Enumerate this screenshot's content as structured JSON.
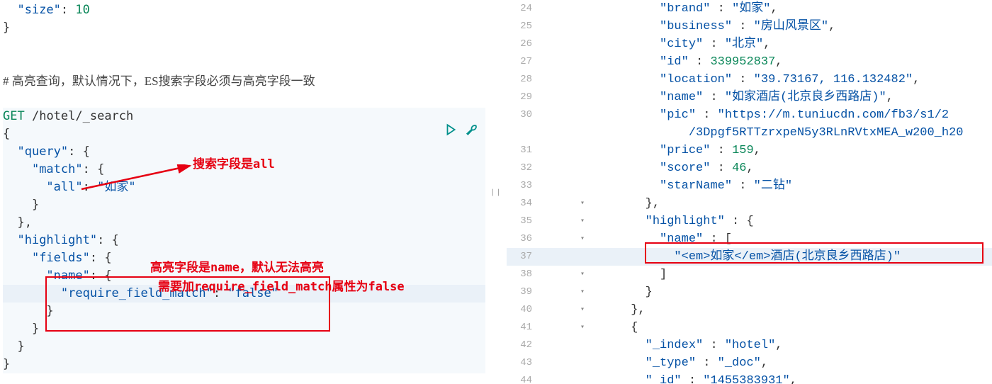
{
  "left": {
    "top_fragment": {
      "key": "\"size\"",
      "val": "10"
    },
    "comment": "# 高亮查询，默认情况下，ES搜索字段必须与高亮字段一致",
    "method": "GET",
    "url": "/hotel/_search",
    "body": {
      "query_key": "\"query\"",
      "match_key": "\"match\"",
      "all_key": "\"all\"",
      "all_val": "\"如家\"",
      "highlight_key": "\"highlight\"",
      "fields_key": "\"fields\"",
      "name_key": "\"name\"",
      "rfm_key": "\"require_field_match\"",
      "rfm_val": "\"false\""
    },
    "anno1": "搜索字段是all",
    "anno2": "高亮字段是name，默认无法高亮",
    "anno3": "需要加require_field_match属性为false"
  },
  "right": {
    "lines": [
      {
        "n": 24,
        "ind": 5,
        "text": "\"brand\" : \"如家\",",
        "segs": [
          [
            "key",
            "\"brand\""
          ],
          [
            "p",
            " : "
          ],
          [
            "str",
            "\"如家\""
          ],
          [
            "p",
            ","
          ]
        ]
      },
      {
        "n": 25,
        "ind": 5,
        "text": "\"business\" : \"房山风景区\",",
        "segs": [
          [
            "key",
            "\"business\""
          ],
          [
            "p",
            " : "
          ],
          [
            "str",
            "\"房山风景区\""
          ],
          [
            "p",
            ","
          ]
        ]
      },
      {
        "n": 26,
        "ind": 5,
        "text": "\"city\" : \"北京\",",
        "segs": [
          [
            "key",
            "\"city\""
          ],
          [
            "p",
            " : "
          ],
          [
            "str",
            "\"北京\""
          ],
          [
            "p",
            ","
          ]
        ]
      },
      {
        "n": 27,
        "ind": 5,
        "text": "\"id\" : 339952837,",
        "segs": [
          [
            "key",
            "\"id\""
          ],
          [
            "p",
            " : "
          ],
          [
            "num",
            "339952837"
          ],
          [
            "p",
            ","
          ]
        ]
      },
      {
        "n": 28,
        "ind": 5,
        "text": "\"location\" : \"39.73167, 116.132482\",",
        "segs": [
          [
            "key",
            "\"location\""
          ],
          [
            "p",
            " : "
          ],
          [
            "str",
            "\"39.73167, 116.132482\""
          ],
          [
            "p",
            ","
          ]
        ]
      },
      {
        "n": 29,
        "ind": 5,
        "text": "\"name\" : \"如家酒店(北京良乡西路店)\",",
        "segs": [
          [
            "key",
            "\"name\""
          ],
          [
            "p",
            " : "
          ],
          [
            "str",
            "\"如家酒店(北京良乡西路店)\""
          ],
          [
            "p",
            ","
          ]
        ]
      },
      {
        "n": 30,
        "ind": 5,
        "text": "\"pic\" : \"https://m.tuniucdn.com/fb3/s1/2…",
        "segs": [
          [
            "key",
            "\"pic\""
          ],
          [
            "p",
            " : "
          ],
          [
            "str",
            "\"https://m.tuniucdn.com/fb3/s1/2"
          ]
        ]
      },
      {
        "n": "30b",
        "ind": 6,
        "text": "/3Dpgf5RTTzrxpeN5y3RLnRVtxMEA_w200_h20",
        "segs": [
          [
            "str",
            "  /3Dpgf5RTTzrxpeN5y3RLnRVtxMEA_w200_h20"
          ]
        ]
      },
      {
        "n": 31,
        "ind": 5,
        "text": "\"price\" : 159,",
        "segs": [
          [
            "key",
            "\"price\""
          ],
          [
            "p",
            " : "
          ],
          [
            "num",
            "159"
          ],
          [
            "p",
            ","
          ]
        ]
      },
      {
        "n": 32,
        "ind": 5,
        "text": "\"score\" : 46,",
        "segs": [
          [
            "key",
            "\"score\""
          ],
          [
            "p",
            " : "
          ],
          [
            "num",
            "46"
          ],
          [
            "p",
            ","
          ]
        ]
      },
      {
        "n": 33,
        "ind": 5,
        "text": "\"starName\" : \"二钻\"",
        "segs": [
          [
            "key",
            "\"starName\""
          ],
          [
            "p",
            " : "
          ],
          [
            "str",
            "\"二钻\""
          ]
        ]
      },
      {
        "n": 34,
        "ind": 4,
        "fold": "▾",
        "text": "},",
        "segs": [
          [
            "p",
            "},"
          ]
        ]
      },
      {
        "n": 35,
        "ind": 4,
        "fold": "▾",
        "text": "\"highlight\" : {",
        "segs": [
          [
            "key",
            "\"highlight\""
          ],
          [
            "p",
            " : {"
          ]
        ]
      },
      {
        "n": 36,
        "ind": 5,
        "fold": "▾",
        "text": "\"name\" : [",
        "segs": [
          [
            "key",
            "\"name\""
          ],
          [
            "p",
            " : ["
          ]
        ]
      },
      {
        "n": 37,
        "ind": 6,
        "hl": true,
        "text": "\"<em>如家</em>酒店(北京良乡西路店)\"",
        "segs": [
          [
            "str",
            "\"<em>如家</em>酒店(北京良乡西路店)\""
          ]
        ]
      },
      {
        "n": 38,
        "ind": 5,
        "fold": "▾",
        "text": "]",
        "segs": [
          [
            "p",
            "]"
          ]
        ]
      },
      {
        "n": 39,
        "ind": 4,
        "fold": "▾",
        "text": "}",
        "segs": [
          [
            "p",
            "}"
          ]
        ]
      },
      {
        "n": 40,
        "ind": 3,
        "fold": "▾",
        "text": "},",
        "segs": [
          [
            "p",
            "},"
          ]
        ]
      },
      {
        "n": 41,
        "ind": 3,
        "fold": "▾",
        "text": "{",
        "segs": [
          [
            "p",
            "{"
          ]
        ]
      },
      {
        "n": 42,
        "ind": 4,
        "text": "\"_index\" : \"hotel\",",
        "segs": [
          [
            "key",
            "\"_index\""
          ],
          [
            "p",
            " : "
          ],
          [
            "str",
            "\"hotel\""
          ],
          [
            "p",
            ","
          ]
        ]
      },
      {
        "n": 43,
        "ind": 4,
        "text": "\"_type\" : \"_doc\",",
        "segs": [
          [
            "key",
            "\"_type\""
          ],
          [
            "p",
            " : "
          ],
          [
            "str",
            "\"_doc\""
          ],
          [
            "p",
            ","
          ]
        ]
      },
      {
        "n": 44,
        "ind": 4,
        "text": "\"_id\" : \"1455383931\",",
        "segs": [
          [
            "key",
            "\"_id\""
          ],
          [
            "p",
            " : "
          ],
          [
            "str",
            "\"1455383931\""
          ],
          [
            "p",
            ","
          ]
        ]
      }
    ]
  }
}
